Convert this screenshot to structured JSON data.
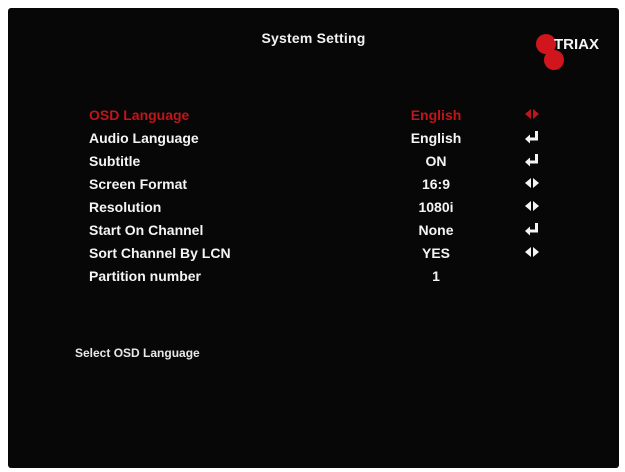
{
  "screen": {
    "title": "System Setting",
    "brand": "TRIAX",
    "colors": {
      "background": "#070707",
      "text": "#f4f4f4",
      "highlight": "#c0151b"
    }
  },
  "menu": {
    "items": [
      {
        "label": "OSD Language",
        "value": "English",
        "control": "left-right-arrows-icon",
        "selected": true
      },
      {
        "label": "Audio Language",
        "value": "English",
        "control": "enter-icon",
        "selected": false
      },
      {
        "label": "Subtitle",
        "value": "ON",
        "control": "enter-icon",
        "selected": false
      },
      {
        "label": "Screen Format",
        "value": "16:9",
        "control": "left-right-arrows-icon",
        "selected": false
      },
      {
        "label": "Resolution",
        "value": "1080i",
        "control": "left-right-arrows-icon",
        "selected": false
      },
      {
        "label": "Start On Channel",
        "value": "None",
        "control": "enter-icon",
        "selected": false
      },
      {
        "label": "Sort Channel By LCN",
        "value": "YES",
        "control": "left-right-arrows-icon",
        "selected": false
      },
      {
        "label": "Partition number",
        "value": "1",
        "control": "",
        "selected": false
      }
    ]
  },
  "hint": {
    "text": "Select OSD Language"
  }
}
